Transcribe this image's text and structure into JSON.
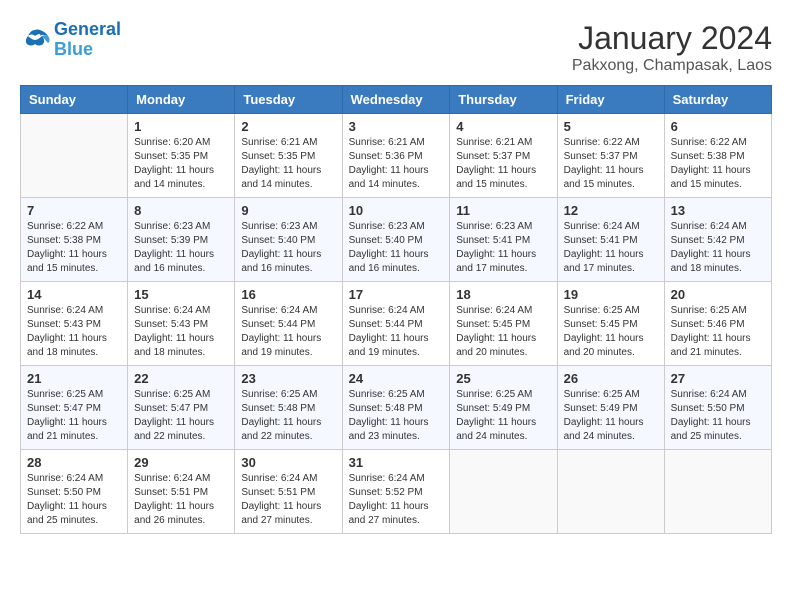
{
  "header": {
    "logo": {
      "line1": "General",
      "line2": "Blue"
    },
    "title": "January 2024",
    "location": "Pakxong, Champasak, Laos"
  },
  "weekdays": [
    "Sunday",
    "Monday",
    "Tuesday",
    "Wednesday",
    "Thursday",
    "Friday",
    "Saturday"
  ],
  "weeks": [
    [
      {
        "day": "",
        "info": ""
      },
      {
        "day": "1",
        "info": "Sunrise: 6:20 AM\nSunset: 5:35 PM\nDaylight: 11 hours\nand 14 minutes."
      },
      {
        "day": "2",
        "info": "Sunrise: 6:21 AM\nSunset: 5:35 PM\nDaylight: 11 hours\nand 14 minutes."
      },
      {
        "day": "3",
        "info": "Sunrise: 6:21 AM\nSunset: 5:36 PM\nDaylight: 11 hours\nand 14 minutes."
      },
      {
        "day": "4",
        "info": "Sunrise: 6:21 AM\nSunset: 5:37 PM\nDaylight: 11 hours\nand 15 minutes."
      },
      {
        "day": "5",
        "info": "Sunrise: 6:22 AM\nSunset: 5:37 PM\nDaylight: 11 hours\nand 15 minutes."
      },
      {
        "day": "6",
        "info": "Sunrise: 6:22 AM\nSunset: 5:38 PM\nDaylight: 11 hours\nand 15 minutes."
      }
    ],
    [
      {
        "day": "7",
        "info": "Sunrise: 6:22 AM\nSunset: 5:38 PM\nDaylight: 11 hours\nand 15 minutes."
      },
      {
        "day": "8",
        "info": "Sunrise: 6:23 AM\nSunset: 5:39 PM\nDaylight: 11 hours\nand 16 minutes."
      },
      {
        "day": "9",
        "info": "Sunrise: 6:23 AM\nSunset: 5:40 PM\nDaylight: 11 hours\nand 16 minutes."
      },
      {
        "day": "10",
        "info": "Sunrise: 6:23 AM\nSunset: 5:40 PM\nDaylight: 11 hours\nand 16 minutes."
      },
      {
        "day": "11",
        "info": "Sunrise: 6:23 AM\nSunset: 5:41 PM\nDaylight: 11 hours\nand 17 minutes."
      },
      {
        "day": "12",
        "info": "Sunrise: 6:24 AM\nSunset: 5:41 PM\nDaylight: 11 hours\nand 17 minutes."
      },
      {
        "day": "13",
        "info": "Sunrise: 6:24 AM\nSunset: 5:42 PM\nDaylight: 11 hours\nand 18 minutes."
      }
    ],
    [
      {
        "day": "14",
        "info": "Sunrise: 6:24 AM\nSunset: 5:43 PM\nDaylight: 11 hours\nand 18 minutes."
      },
      {
        "day": "15",
        "info": "Sunrise: 6:24 AM\nSunset: 5:43 PM\nDaylight: 11 hours\nand 18 minutes."
      },
      {
        "day": "16",
        "info": "Sunrise: 6:24 AM\nSunset: 5:44 PM\nDaylight: 11 hours\nand 19 minutes."
      },
      {
        "day": "17",
        "info": "Sunrise: 6:24 AM\nSunset: 5:44 PM\nDaylight: 11 hours\nand 19 minutes."
      },
      {
        "day": "18",
        "info": "Sunrise: 6:24 AM\nSunset: 5:45 PM\nDaylight: 11 hours\nand 20 minutes."
      },
      {
        "day": "19",
        "info": "Sunrise: 6:25 AM\nSunset: 5:45 PM\nDaylight: 11 hours\nand 20 minutes."
      },
      {
        "day": "20",
        "info": "Sunrise: 6:25 AM\nSunset: 5:46 PM\nDaylight: 11 hours\nand 21 minutes."
      }
    ],
    [
      {
        "day": "21",
        "info": "Sunrise: 6:25 AM\nSunset: 5:47 PM\nDaylight: 11 hours\nand 21 minutes."
      },
      {
        "day": "22",
        "info": "Sunrise: 6:25 AM\nSunset: 5:47 PM\nDaylight: 11 hours\nand 22 minutes."
      },
      {
        "day": "23",
        "info": "Sunrise: 6:25 AM\nSunset: 5:48 PM\nDaylight: 11 hours\nand 22 minutes."
      },
      {
        "day": "24",
        "info": "Sunrise: 6:25 AM\nSunset: 5:48 PM\nDaylight: 11 hours\nand 23 minutes."
      },
      {
        "day": "25",
        "info": "Sunrise: 6:25 AM\nSunset: 5:49 PM\nDaylight: 11 hours\nand 24 minutes."
      },
      {
        "day": "26",
        "info": "Sunrise: 6:25 AM\nSunset: 5:49 PM\nDaylight: 11 hours\nand 24 minutes."
      },
      {
        "day": "27",
        "info": "Sunrise: 6:24 AM\nSunset: 5:50 PM\nDaylight: 11 hours\nand 25 minutes."
      }
    ],
    [
      {
        "day": "28",
        "info": "Sunrise: 6:24 AM\nSunset: 5:50 PM\nDaylight: 11 hours\nand 25 minutes."
      },
      {
        "day": "29",
        "info": "Sunrise: 6:24 AM\nSunset: 5:51 PM\nDaylight: 11 hours\nand 26 minutes."
      },
      {
        "day": "30",
        "info": "Sunrise: 6:24 AM\nSunset: 5:51 PM\nDaylight: 11 hours\nand 27 minutes."
      },
      {
        "day": "31",
        "info": "Sunrise: 6:24 AM\nSunset: 5:52 PM\nDaylight: 11 hours\nand 27 minutes."
      },
      {
        "day": "",
        "info": ""
      },
      {
        "day": "",
        "info": ""
      },
      {
        "day": "",
        "info": ""
      }
    ]
  ]
}
